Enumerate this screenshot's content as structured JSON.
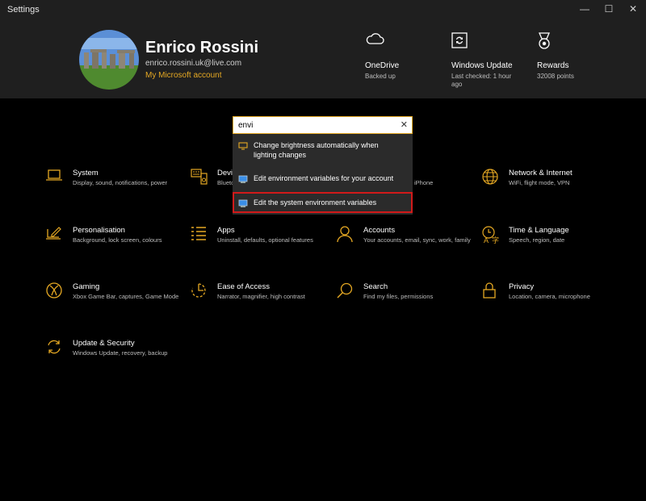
{
  "window": {
    "title": "Settings",
    "minimize": "—",
    "maximize": "☐",
    "close": "✕"
  },
  "user": {
    "name": "Enrico Rossini",
    "email": "enrico.rossini.uk@live.com",
    "account_link": "My Microsoft account"
  },
  "tiles": [
    {
      "icon": "cloud-icon",
      "title": "OneDrive",
      "subtitle": "Backed up"
    },
    {
      "icon": "windows-update-icon",
      "title": "Windows Update",
      "subtitle": "Last checked: 1 hour ago"
    },
    {
      "icon": "rewards-medal-icon",
      "title": "Rewards",
      "subtitle": "32008 points"
    }
  ],
  "search": {
    "value": "envi",
    "clear_glyph": "✕"
  },
  "suggestions": [
    {
      "label": "Change brightness automatically when lighting changes",
      "icon": "monitor-icon"
    },
    {
      "label": "Edit environment variables for your account",
      "icon": "system-properties-icon"
    },
    {
      "label": "Edit the system environment variables",
      "icon": "system-properties-icon"
    }
  ],
  "categories": {
    "system": {
      "title": "System",
      "subtitle": "Display, sound, notifications, power"
    },
    "devices": {
      "title": "Devic",
      "subtitle": "Blueto"
    },
    "phone": {
      "subtitle": "iPhone"
    },
    "network": {
      "title": "Network & Internet",
      "subtitle": "WiFi, flight mode, VPN"
    },
    "personalisation": {
      "title": "Personalisation",
      "subtitle": "Background, lock screen, colours"
    },
    "apps": {
      "title": "Apps",
      "subtitle": "Uninstall, defaults, optional features"
    },
    "accounts": {
      "title": "Accounts",
      "subtitle": "Your accounts, email, sync, work, family"
    },
    "time": {
      "title": "Time & Language",
      "subtitle": "Speech, region, date"
    },
    "gaming": {
      "title": "Gaming",
      "subtitle": "Xbox Game Bar, captures, Game Mode"
    },
    "ease": {
      "title": "Ease of Access",
      "subtitle": "Narrator, magnifier, high contrast"
    },
    "search": {
      "title": "Search",
      "subtitle": "Find my files, permissions"
    },
    "privacy": {
      "title": "Privacy",
      "subtitle": "Location, camera, microphone"
    },
    "update": {
      "title": "Update & Security",
      "subtitle": "Windows Update, recovery, backup"
    }
  },
  "colors": {
    "accent": "#e5a823",
    "highlight_border": "#d11a1a",
    "header_bg": "#1f1f1f"
  }
}
